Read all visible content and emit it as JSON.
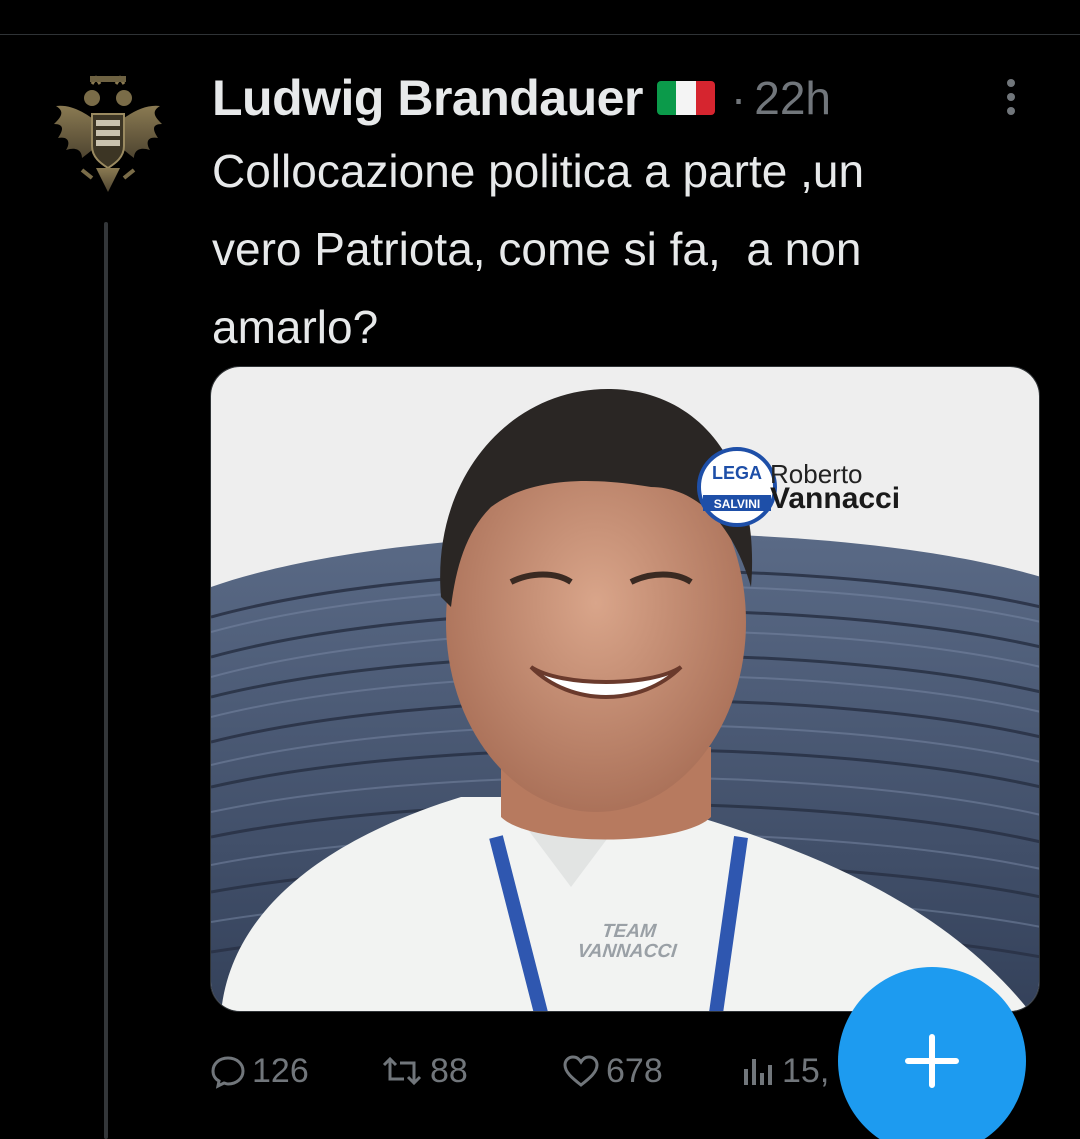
{
  "tweet": {
    "author": {
      "display_name": "Ludwig Brandauer",
      "flag_icon": "italy-flag-icon",
      "avatar_icon": "double-headed-eagle-crest-icon"
    },
    "separator": "·",
    "timestamp": "22h",
    "more_icon": "more-vertical-icon",
    "text": "Collocazione politica a parte ,un\nvero Patriota, come si fa,  a non\namarlo?",
    "media": {
      "logo_line_1": "Roberto",
      "logo_line_2": "Vannacci",
      "logo_badge": "LEGA",
      "logo_badge_sub": "SALVINI",
      "watermark_line_1": "TEAM",
      "watermark_line_2": "VANNACCI"
    },
    "actions": {
      "replies": "126",
      "reposts": "88",
      "likes": "678",
      "views": "15,"
    }
  },
  "compose_button": {
    "icon": "plus-icon"
  },
  "colors": {
    "background": "#000000",
    "text_primary": "#e7e9ea",
    "text_secondary": "#71767b",
    "accent": "#1d9bf0",
    "divider": "#2f3336"
  }
}
